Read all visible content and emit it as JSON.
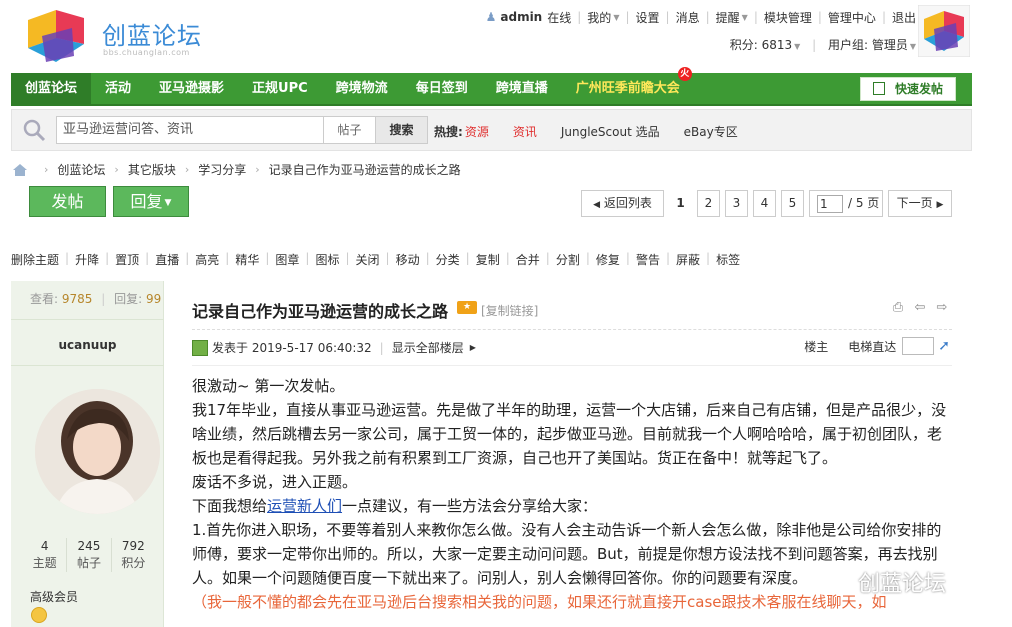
{
  "site": {
    "name": "创蓝论坛",
    "url": "bbs.chuanglan.com"
  },
  "topbar": {
    "user": "admin",
    "status": "在线",
    "links": [
      "我的",
      "设置",
      "消息",
      "提醒",
      "模块管理",
      "管理中心",
      "退出"
    ],
    "credits_label": "积分: 6813",
    "group_label": "用户组: 管理员"
  },
  "nav": {
    "items": [
      "创蓝论坛",
      "活动",
      "亚马逊摄影",
      "正规UPC",
      "跨境物流",
      "每日签到",
      "跨境直播",
      "广州旺季前瞻大会"
    ],
    "hot_badge": "火",
    "quick_post": "快速发帖"
  },
  "search": {
    "placeholder": "亚马逊运营问答、资讯",
    "type": "帖子",
    "button": "搜索",
    "hot_label": "热搜:",
    "keywords": [
      "资源",
      "资讯",
      "JungleScout 选品",
      "eBay专区"
    ]
  },
  "breadcrumb": [
    "创蓝论坛",
    "其它版块",
    "学习分享",
    "记录自己作为亚马逊运营的成长之路"
  ],
  "actions": {
    "post": "发帖",
    "reply": "回复"
  },
  "pager": {
    "back": "返回列表",
    "pages": [
      "1",
      "2",
      "3",
      "4",
      "5"
    ],
    "current": "1",
    "total": "/ 5 页",
    "next": "下一页"
  },
  "modbar": [
    "删除主题",
    "升降",
    "置顶",
    "直播",
    "高亮",
    "精华",
    "图章",
    "图标",
    "关闭",
    "移动",
    "分类",
    "复制",
    "合并",
    "分割",
    "修复",
    "警告",
    "屏蔽",
    "标签"
  ],
  "author": {
    "views_label": "查看:",
    "views": "9785",
    "replies_label": "回复:",
    "replies": "99",
    "name": "ucanuup",
    "stats": [
      {
        "n": "4",
        "l": "主题"
      },
      {
        "n": "245",
        "l": "帖子"
      },
      {
        "n": "792",
        "l": "积分"
      }
    ],
    "grade": "高级会员"
  },
  "post": {
    "title": "记录自己作为亚马逊运营的成长之路",
    "copy_link": "[复制链接]",
    "published": "发表于 2019-5-17 06:40:32",
    "show_all": "显示全部楼层",
    "floor_label": "楼主",
    "jump_label": "电梯直达",
    "p1": "很激动~  第一次发帖。",
    "p2": "我17年毕业，直接从事亚马逊运营。先是做了半年的助理，运营一个大店铺，后来自己有店铺，但是产品很少，没啥业绩，然后跳槽去另一家公司，属于工贸一体的，起步做亚马逊。目前就我一个人啊哈哈哈，属于初创团队，老板也是看得起我。另外我之前有积累到工厂资源，自己也开了美国站。货正在备中！就等起飞了。",
    "p3": "废话不多说，进入正题。",
    "p4a": "下面我想给",
    "p4link": "运营新人们",
    "p4b": "一点建议，有一些方法会分享给大家：",
    "p5": "1.首先你进入职场，不要等着别人来教你怎么做。没有人会主动告诉一个新人会怎么做，除非他是公司给你安排的师傅，要求一定带你出师的。所以，大家一定要主动问问题。But，前提是你想方设法找不到问题答案，再去找别人。如果一个问题随便百度一下就出来了。问别人，别人会懒得回答你。你的问题要有深度。",
    "p6": "（我一般不懂的都会先在亚马逊后台搜索相关我的问题，如果还行就直接开case跟技术客服在线聊天，如"
  },
  "watermark": "创蓝论坛",
  "colors": {
    "nav_green": "#3d9a34",
    "button_green": "#5cb85c",
    "link_blue": "#1e4fb5",
    "accent_orange": "#e8663a"
  }
}
